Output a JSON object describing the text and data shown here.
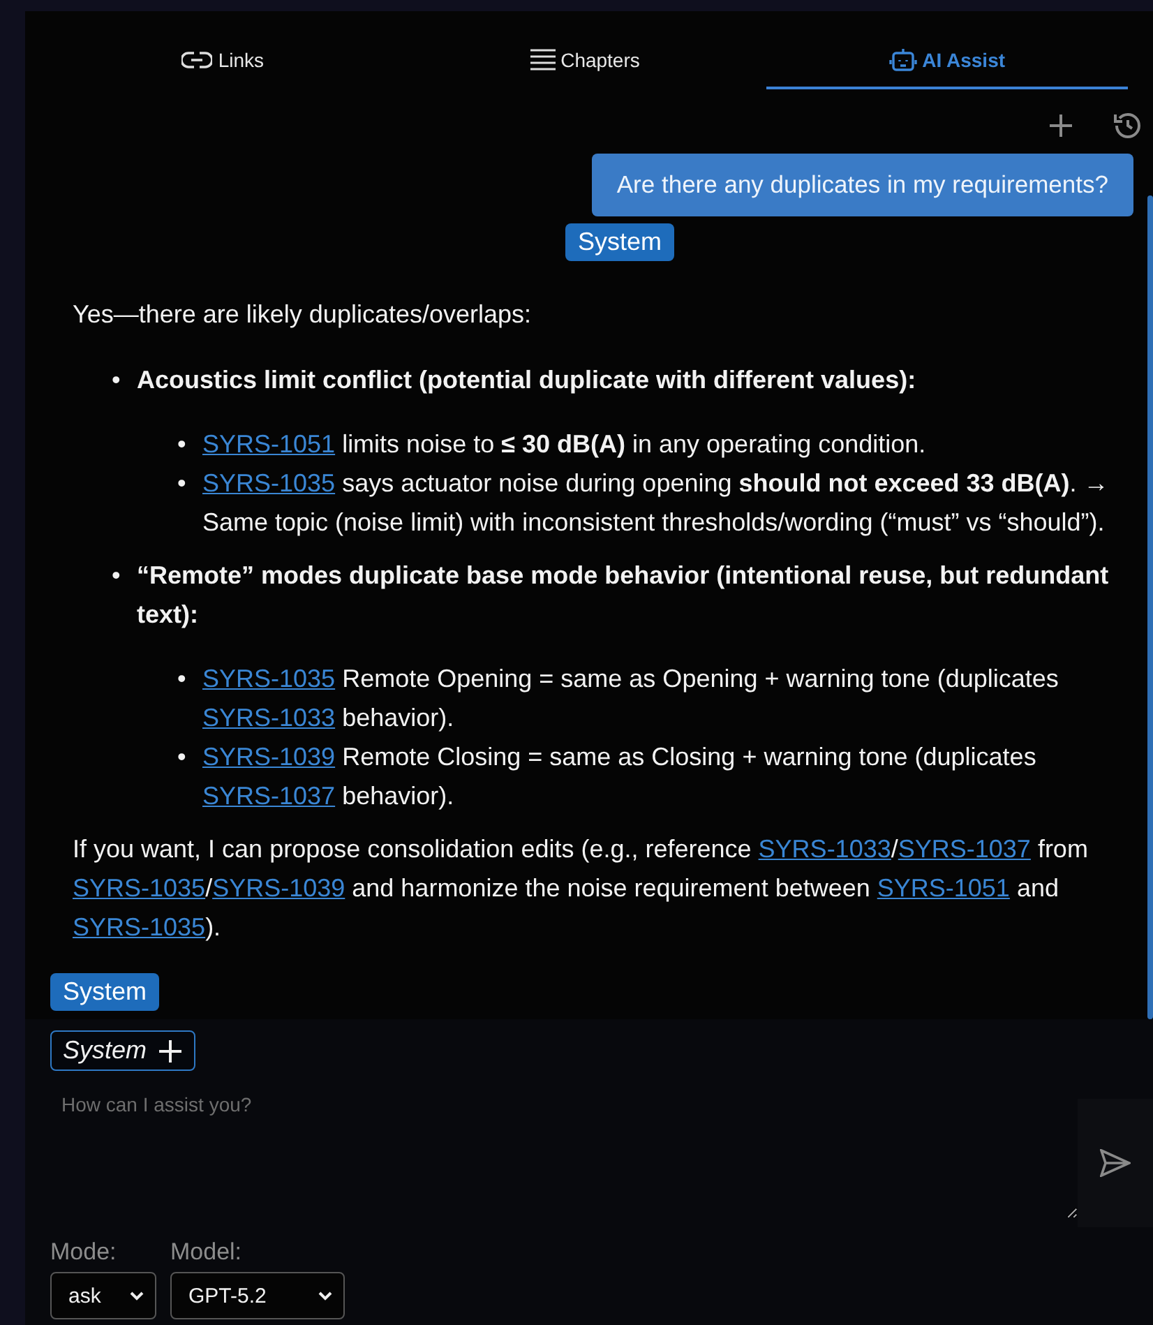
{
  "tabs": [
    {
      "label": "Links",
      "selected": false
    },
    {
      "label": "Chapters",
      "selected": false
    },
    {
      "label": "AI Assist",
      "selected": true
    }
  ],
  "messages": [
    {
      "kind": "user",
      "text": "Are there any duplicates in my requirements?",
      "tag": "System"
    },
    {
      "kind": "assistant",
      "intro": "Yes—there are likely duplicates/overlaps:",
      "sections": [
        {
          "bullet": "•",
          "sub_bullet": "•",
          "heading": "Acoustics limit conflict (potential duplicate with different values):",
          "items": [
            [
              {
                "kind": "link",
                "text": "SYRS-1051"
              },
              {
                "kind": "text",
                "text": " limits noise to **≤ 30 dB(A)** in any operating condition."
              }
            ],
            [
              {
                "kind": "link",
                "text": "SYRS-1035"
              },
              {
                "kind": "text",
                "text": " says actuator noise during opening **should not exceed 33 dB(A)**. → Same topic (noise limit) with inconsistent thresholds/wording (“must” vs “should”)."
              }
            ]
          ]
        },
        {
          "bullet": "•",
          "sub_bullet": "•",
          "heading": "“Remote” modes duplicate base mode behavior (intentional reuse, but redundant text):",
          "items": [
            [
              {
                "kind": "link",
                "text": "SYRS-1035"
              },
              {
                "kind": "text",
                "text": " Remote Opening = same as Opening + warning tone (duplicates "
              },
              {
                "kind": "link",
                "text": "SYRS-1033"
              },
              {
                "kind": "text",
                "text": " behavior)."
              }
            ],
            [
              {
                "kind": "link",
                "text": "SYRS-1039"
              },
              {
                "kind": "text",
                "text": " Remote Closing = same as Closing + warning tone (duplicates "
              },
              {
                "kind": "link",
                "text": "SYRS-1037"
              },
              {
                "kind": "text",
                "text": " behavior)."
              }
            ]
          ]
        }
      ],
      "closing": [
        {
          "kind": "text",
          "text": "If you want, I can propose consolidation edits (e.g., reference "
        },
        {
          "kind": "link",
          "text": "SYRS-1033"
        },
        {
          "kind": "text",
          "text": "/"
        },
        {
          "kind": "link",
          "text": "SYRS-1037"
        },
        {
          "kind": "text",
          "text": " from "
        },
        {
          "kind": "link",
          "text": "SYRS-1035"
        },
        {
          "kind": "text",
          "text": "/"
        },
        {
          "kind": "link",
          "text": "SYRS-1039"
        },
        {
          "kind": "text",
          "text": " and harmonize the noise requirement between "
        },
        {
          "kind": "link",
          "text": "SYRS-1051"
        },
        {
          "kind": "text",
          "text": " and "
        },
        {
          "kind": "link",
          "text": "SYRS-1035"
        },
        {
          "kind": "text",
          "text": ")."
        }
      ],
      "tag": "System"
    }
  ],
  "composer": {
    "chip": "System",
    "placeholder": "How can I assist you?"
  },
  "mode": {
    "label": "Mode:",
    "value": "ask"
  },
  "model": {
    "label": "Model:",
    "value": "GPT-5.2"
  }
}
